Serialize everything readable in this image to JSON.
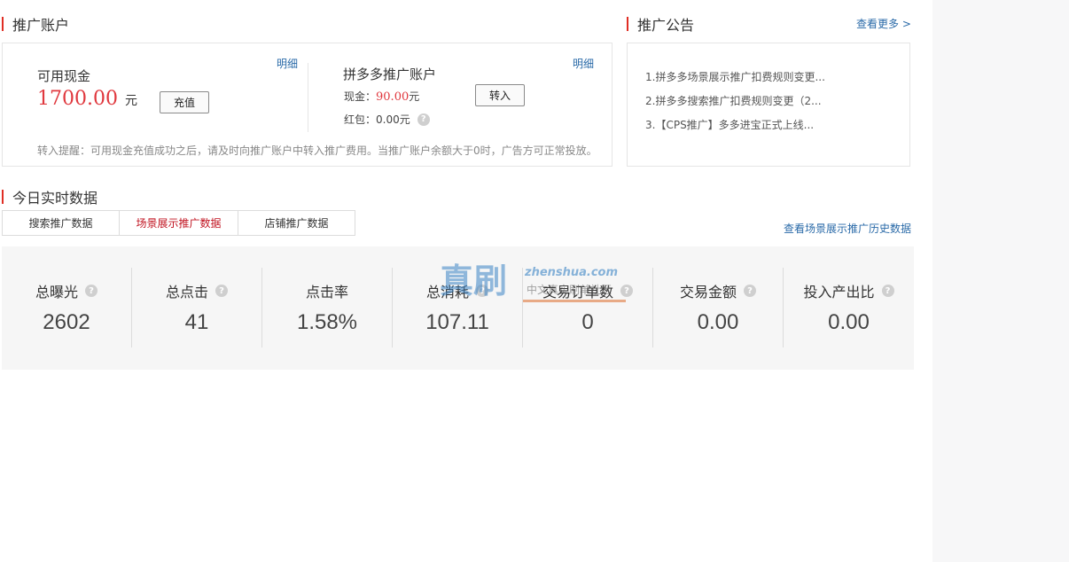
{
  "account": {
    "title": "推广账户",
    "cash_label": "可用现金",
    "cash_detail": "明细",
    "cash_amount": "1700.00",
    "cash_unit": "元",
    "recharge_button": "充值",
    "pdd_title": "拼多多推广账户",
    "pdd_detail": "明细",
    "pdd_cash_label": "现金：",
    "pdd_cash_value": "90.00",
    "pdd_cash_unit": "元",
    "pdd_redpacket": "红包：0.00元",
    "transfer_button": "转入",
    "tip": "转入提醒：可用现金充值成功之后，请及时向推广账户中转入推广费用。当推广账户余额大于0时，广告方可正常投放。"
  },
  "notice": {
    "title": "推广公告",
    "more": "查看更多 >",
    "items": [
      "1.拼多多场景展示推广扣费规则变更...",
      "2.拼多多搜索推广扣费规则变更（2...",
      "3.【CPS推广】多多进宝正式上线..."
    ]
  },
  "realtime": {
    "title": "今日实时数据",
    "history_link": "查看场景展示推广历史数据",
    "tabs": [
      "搜索推广数据",
      "场景展示推广数据",
      "店铺推广数据"
    ],
    "active_tab": 1,
    "stats": [
      {
        "label": "总曝光",
        "value": "2602",
        "help": true
      },
      {
        "label": "总点击",
        "value": "41",
        "help": true
      },
      {
        "label": "点击率",
        "value": "1.58%",
        "help": false
      },
      {
        "label": "总消耗",
        "value": "107.11",
        "help": true
      },
      {
        "label": "交易订单数",
        "value": "0",
        "help": true
      },
      {
        "label": "交易金额",
        "value": "0.00",
        "help": true
      },
      {
        "label": "投入产出比",
        "value": "0.00",
        "help": true
      }
    ]
  },
  "watermark": {
    "text_cn": "真刷",
    "text_en": "zhenshua.com",
    "sub": "中文真实刷单社区"
  },
  "colors": {
    "accent_red": "#e02e24",
    "link_blue": "#2a6aa8",
    "amount_red": "#e0383e"
  }
}
